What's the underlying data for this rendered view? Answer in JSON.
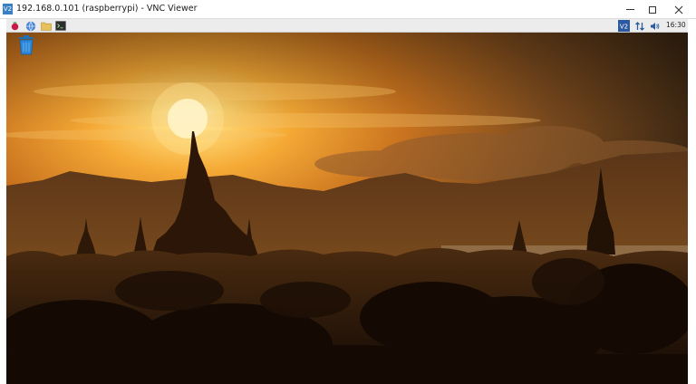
{
  "window": {
    "app_icon_text": "V2",
    "title": "192.168.0.101 (raspberrypi) - VNC Viewer",
    "controls": [
      "minimize-icon",
      "maximize-icon",
      "close-icon"
    ]
  },
  "panel": {
    "left_icons": [
      "raspberry-menu-icon",
      "web-browser-icon",
      "file-manager-icon",
      "terminal-icon"
    ],
    "right_icons": [
      "vnc-server-icon",
      "network-icon",
      "volume-icon"
    ],
    "clock": "16:30"
  },
  "desktop": {
    "icons": [
      "trash-icon"
    ],
    "wallpaper": "sunset-temples-icon"
  },
  "colors": {
    "sky_top": "#3b2a14",
    "sky_glow": "#f6b54a",
    "sun": "#fff6c8",
    "silhouette": "#2a1607",
    "panel_bg": "#ececec",
    "vnc_blue": "#2c5aa0"
  }
}
